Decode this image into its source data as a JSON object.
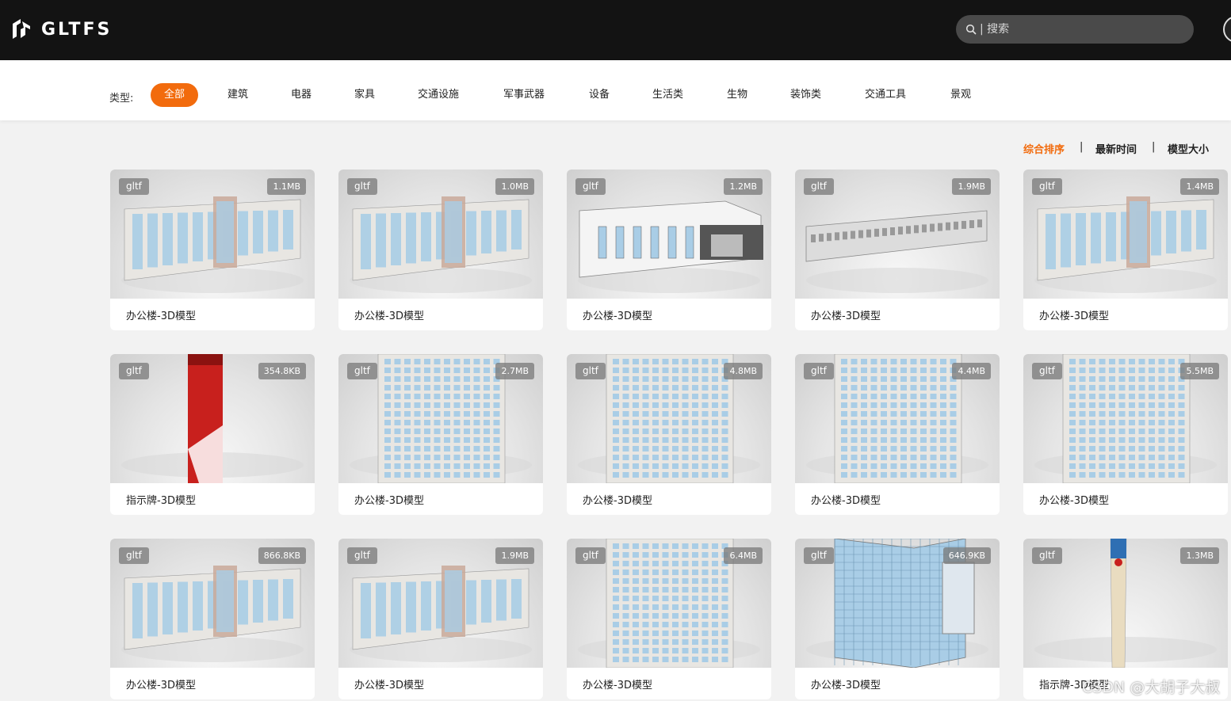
{
  "header": {
    "logo_text": "GLTFS",
    "search_placeholder": "| 搜索"
  },
  "filter": {
    "label": "类型:",
    "categories": [
      "全部",
      "建筑",
      "电器",
      "家具",
      "交通设施",
      "军事武器",
      "设备",
      "生活类",
      "生物",
      "装饰类",
      "交通工具",
      "景观"
    ],
    "active": "全部"
  },
  "sort": {
    "options": [
      "综合排序",
      "最新时间",
      "模型大小"
    ],
    "separator": "|",
    "active": "综合排序"
  },
  "colors": {
    "accent": "#f26b0d",
    "header_bg": "#131313"
  },
  "cards": [
    {
      "type": "gltf",
      "size": "1.1MB",
      "title": "办公楼-3D模型",
      "thumb": "building-low"
    },
    {
      "type": "gltf",
      "size": "1.0MB",
      "title": "办公楼-3D模型",
      "thumb": "building-low"
    },
    {
      "type": "gltf",
      "size": "1.2MB",
      "title": "办公楼-3D模型",
      "thumb": "building-white"
    },
    {
      "type": "gltf",
      "size": "1.9MB",
      "title": "办公楼-3D模型",
      "thumb": "building-long"
    },
    {
      "type": "gltf",
      "size": "1.4MB",
      "title": "办公楼-3D模型",
      "thumb": "building-low"
    },
    {
      "type": "gltf",
      "size": "354.8KB",
      "title": "指示牌-3D模型",
      "thumb": "sign-red"
    },
    {
      "type": "gltf",
      "size": "2.7MB",
      "title": "办公楼-3D模型",
      "thumb": "building-tall"
    },
    {
      "type": "gltf",
      "size": "4.8MB",
      "title": "办公楼-3D模型",
      "thumb": "building-tall"
    },
    {
      "type": "gltf",
      "size": "4.4MB",
      "title": "办公楼-3D模型",
      "thumb": "building-tall"
    },
    {
      "type": "gltf",
      "size": "5.5MB",
      "title": "办公楼-3D模型",
      "thumb": "building-tall"
    },
    {
      "type": "gltf",
      "size": "866.8KB",
      "title": "办公楼-3D模型",
      "thumb": "building-low"
    },
    {
      "type": "gltf",
      "size": "1.9MB",
      "title": "办公楼-3D模型",
      "thumb": "building-low"
    },
    {
      "type": "gltf",
      "size": "6.4MB",
      "title": "办公楼-3D模型",
      "thumb": "building-tall"
    },
    {
      "type": "gltf",
      "size": "646.9KB",
      "title": "办公楼-3D模型",
      "thumb": "building-glass"
    },
    {
      "type": "gltf",
      "size": "1.3MB",
      "title": "指示牌-3D模型",
      "thumb": "sign-tall"
    }
  ],
  "watermark": "CSDN @大胡子大叔"
}
